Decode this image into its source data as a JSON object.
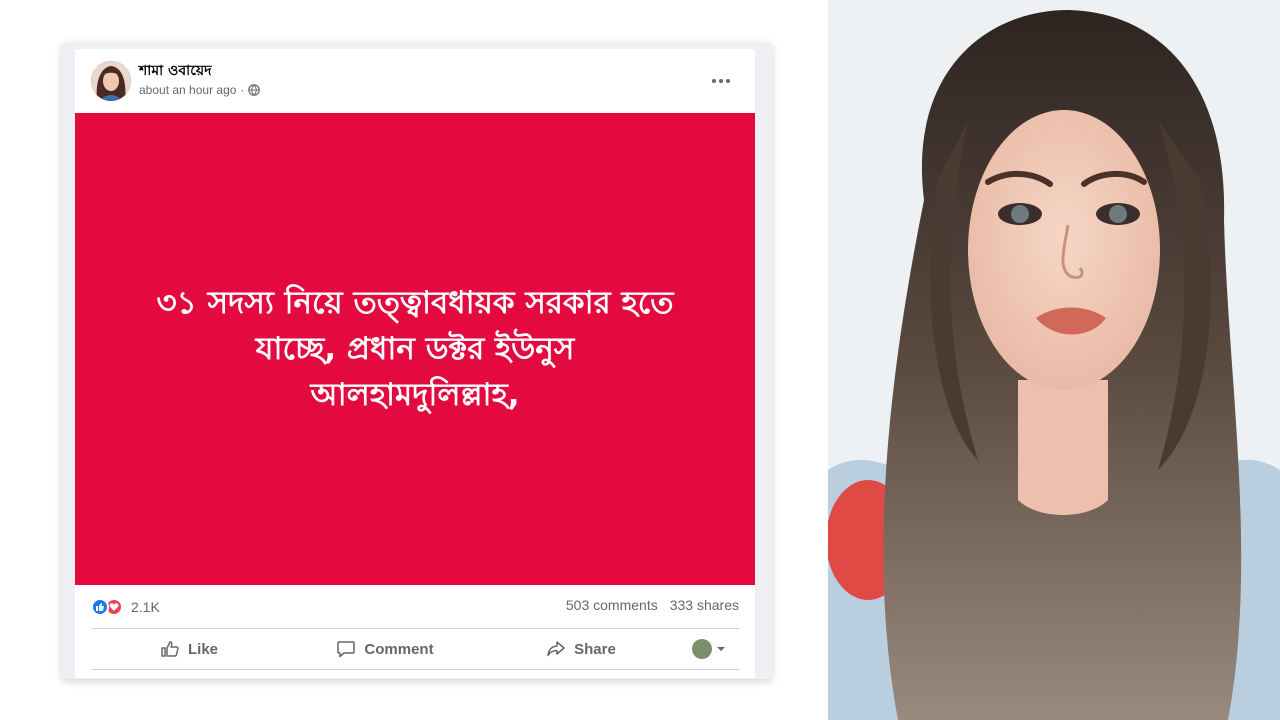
{
  "post": {
    "author_name": "শামা ওবায়েদ",
    "timestamp": "about an hour ago",
    "separator": "·",
    "privacy_icon": "globe-icon",
    "more_icon": "more-options-icon",
    "background_color": "#e4093f",
    "text_line1": "৩১ সদস্য নিয়ে তত্ত্বাবধায়ক সরকার হতে",
    "text_line2": "যাচ্ছে, প্রধান ডক্টর ইউনুস",
    "text_line3": "আলহামদুলিল্লাহ,"
  },
  "stats": {
    "reaction_icons": [
      "like-reaction-icon",
      "love-reaction-icon"
    ],
    "reaction_count": "2.1K",
    "comments": "503 comments",
    "shares": "333 shares"
  },
  "actions": {
    "like_label": "Like",
    "comment_label": "Comment",
    "share_label": "Share"
  },
  "colors": {
    "like_blue": "#1877f2",
    "love_red": "#f33e58",
    "secondary_text": "#65676b"
  }
}
